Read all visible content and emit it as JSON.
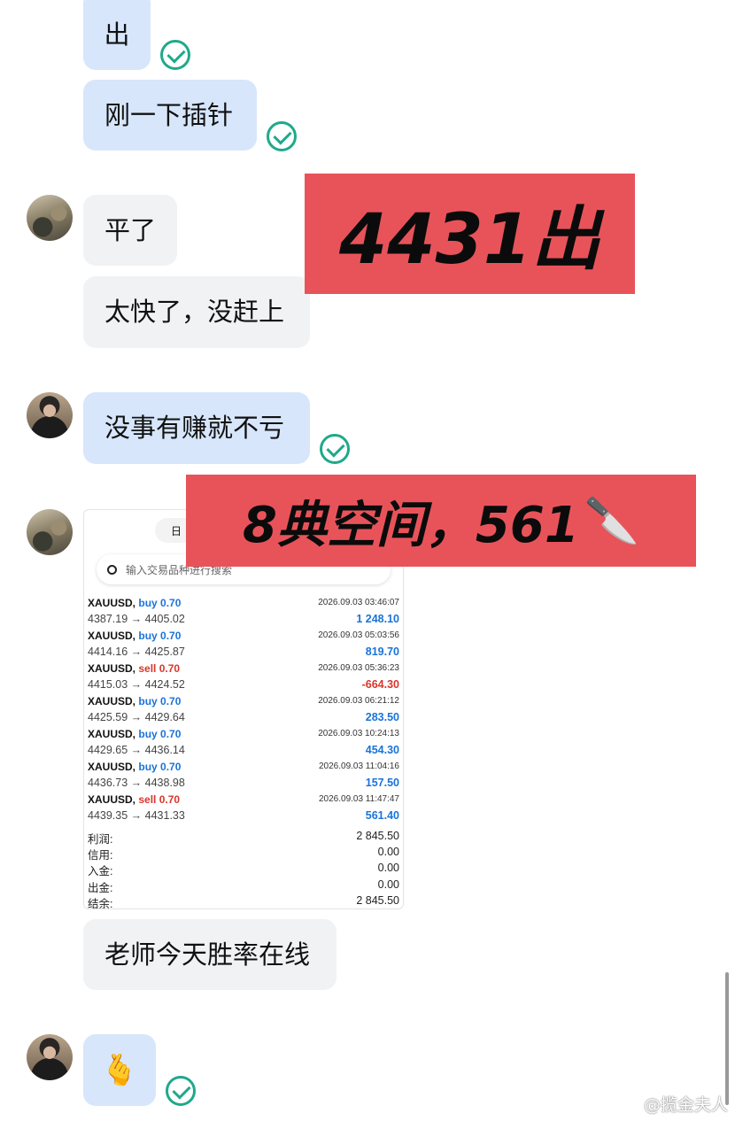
{
  "messages": {
    "m1": "出",
    "m2": "刚一下插针",
    "m3": "平了",
    "m4": "太快了，没赶上",
    "m5": "没事有赚就不亏",
    "m6": "老师今天胜率在线",
    "m7_emoji": "🫰"
  },
  "banners": {
    "top": "4431出",
    "middle": "8典空间，561",
    "middle_icon": "🔪"
  },
  "card": {
    "date_tab": "日",
    "search_placeholder": "输入交易品种进行搜索",
    "trades": [
      {
        "symbol": "XAUUSD,",
        "direction": "buy",
        "volume": "0.70",
        "time": "2026.09.03 03:46:07",
        "prices": "4387.19 → 4405.02",
        "profit": "1 248.10",
        "sign": "pos"
      },
      {
        "symbol": "XAUUSD,",
        "direction": "buy",
        "volume": "0.70",
        "time": "2026.09.03 05:03:56",
        "prices": "4414.16 → 4425.87",
        "profit": "819.70",
        "sign": "pos"
      },
      {
        "symbol": "XAUUSD,",
        "direction": "sell",
        "volume": "0.70",
        "time": "2026.09.03 05:36:23",
        "prices": "4415.03 → 4424.52",
        "profit": "-664.30",
        "sign": "neg"
      },
      {
        "symbol": "XAUUSD,",
        "direction": "buy",
        "volume": "0.70",
        "time": "2026.09.03 06:21:12",
        "prices": "4425.59 → 4429.64",
        "profit": "283.50",
        "sign": "pos"
      },
      {
        "symbol": "XAUUSD,",
        "direction": "buy",
        "volume": "0.70",
        "time": "2026.09.03 10:24:13",
        "prices": "4429.65 → 4436.14",
        "profit": "454.30",
        "sign": "pos"
      },
      {
        "symbol": "XAUUSD,",
        "direction": "buy",
        "volume": "0.70",
        "time": "2026.09.03 11:04:16",
        "prices": "4436.73 → 4438.98",
        "profit": "157.50",
        "sign": "pos"
      },
      {
        "symbol": "XAUUSD,",
        "direction": "sell",
        "volume": "0.70",
        "time": "2026.09.03 11:47:47",
        "prices": "4439.35 → 4431.33",
        "profit": "561.40",
        "sign": "pos"
      }
    ],
    "summary": [
      {
        "label": "利润:",
        "value": "2 845.50"
      },
      {
        "label": "信用:",
        "value": "0.00"
      },
      {
        "label": "入金:",
        "value": "0.00"
      },
      {
        "label": "出金:",
        "value": "0.00"
      },
      {
        "label": "结余:",
        "value": "2 845.50"
      }
    ]
  },
  "watermark": "@揽金夫人",
  "colors": {
    "own_bubble": "#d7e6fb",
    "other_bubble": "#f1f2f4",
    "banner": "#e8535a",
    "check": "#1fa98b",
    "buy": "#1a73d9",
    "sell": "#d9362b"
  }
}
